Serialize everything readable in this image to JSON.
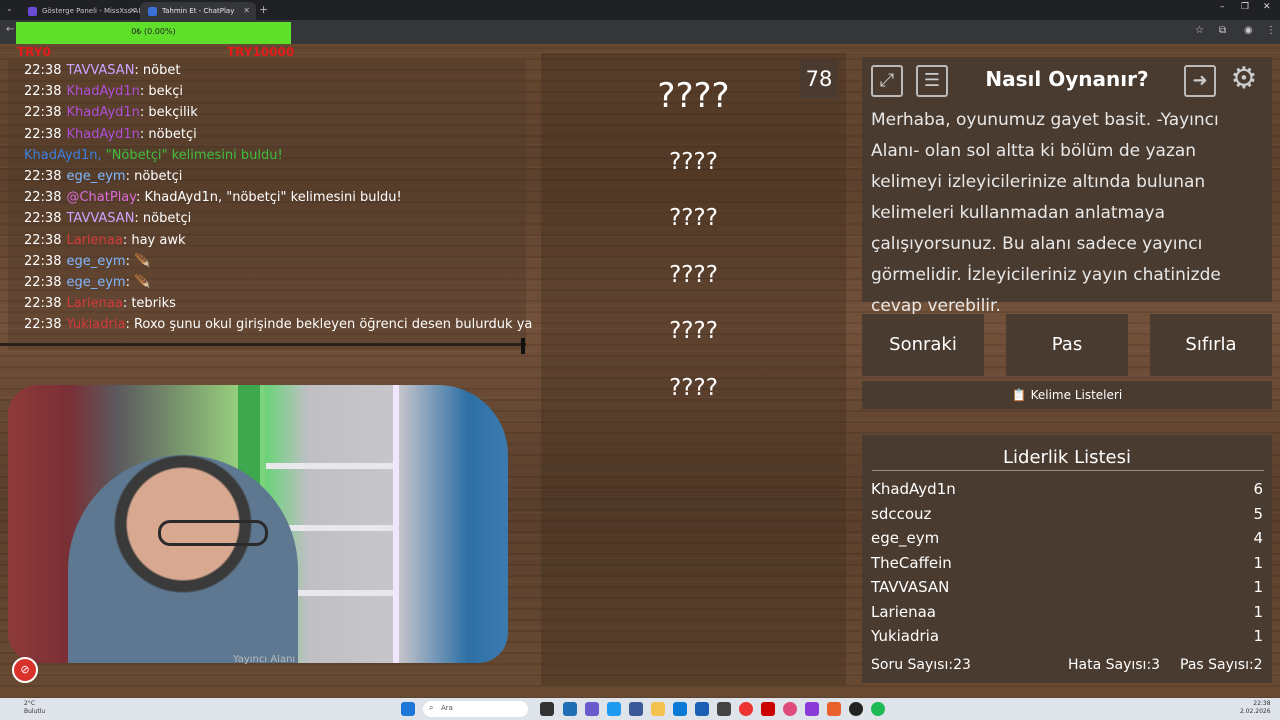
{
  "browser": {
    "tabs": [
      {
        "title": "Gösterge Paneli - MissXss AI B...",
        "active": false
      },
      {
        "title": "Tahmin Et - ChatPlay",
        "active": true
      }
    ],
    "new_tab": "+"
  },
  "overlay": {
    "progress_text": "0₺ (0.00%)",
    "progress_fraction": 0.0,
    "min_label": "TRY0",
    "max_label": "TRY10000"
  },
  "chat": {
    "lines": [
      {
        "time": "22:38",
        "user": "TAVVASAN",
        "user_color": "#c8a6ff",
        "message": ": nöbet"
      },
      {
        "time": "22:38",
        "user": "KhadAyd1n",
        "user_color": "#b04fd6",
        "message": ": bekçi"
      },
      {
        "time": "22:38",
        "user": "KhadAyd1n",
        "user_color": "#b04fd6",
        "message": ": bekçilik"
      },
      {
        "time": "22:38",
        "user": "KhadAyd1n",
        "user_color": "#b04fd6",
        "message": ": nöbetçi"
      },
      {
        "time": "",
        "user": "KhadAyd1n, ",
        "user_color": "#3a7fe0",
        "message": "\"Nöbetçi\" kelimesini buldu!",
        "system": true
      },
      {
        "time": "22:38",
        "user": "ege_eym",
        "user_color": "#7fb6ff",
        "message": ": nöbetçi"
      },
      {
        "time": "22:38",
        "user": "@ChatPlay",
        "user_color": "#d86bd8",
        "message": ": KhadAyd1n, \"nöbetçi\" kelimesini buldu!"
      },
      {
        "time": "22:38",
        "user": "TAVVASAN",
        "user_color": "#c8a6ff",
        "message": ": nöbetçi"
      },
      {
        "time": "22:38",
        "user": "Larienaa",
        "user_color": "#d23a3a",
        "message": ": hay awk"
      },
      {
        "time": "22:38",
        "user": "ege_eym",
        "user_color": "#7fb6ff",
        "message": ": 🪶"
      },
      {
        "time": "22:38",
        "user": "ege_eym",
        "user_color": "#7fb6ff",
        "message": ": 🪶"
      },
      {
        "time": "22:38",
        "user": "Larienaa",
        "user_color": "#d23a3a",
        "message": ": tebriks"
      },
      {
        "time": "22:38",
        "user": "Yukiadria",
        "user_color": "#d23a3a",
        "message": ": Roxo şunu okul girişinde bekleyen öğrenci desen bulurduk ya"
      }
    ]
  },
  "webcam": {
    "label": "Yayıncı Alanı",
    "rec_icon": "record-icon"
  },
  "board": {
    "counter": "78",
    "words": [
      "????",
      "????",
      "????",
      "????",
      "????",
      "????"
    ]
  },
  "howto": {
    "title": "Nasıl Oynanır?",
    "text": "Merhaba, oyunumuz gayet basit. -Yayıncı Alanı- olan sol altta ki bölüm de yazan kelimeyi izleyicilerinize altında bulunan kelimeleri kullanmadan anlatmaya çalışıyorsunuz. Bu alanı sadece yayıncı görmelidir. İzleyicileriniz yayın chatinizde cevap verebilir.",
    "icons": {
      "fullscreen": "fullscreen-icon",
      "list": "document-icon",
      "exit": "exit-icon",
      "settings": "gear-icon"
    }
  },
  "controls": {
    "next": "Sonraki",
    "pass": "Pas",
    "reset": "Sıfırla",
    "word_lists": "Kelime Listeleri",
    "word_lists_icon": "📋"
  },
  "leaderboard": {
    "title": "Liderlik Listesi",
    "rows": [
      {
        "name": "KhadAyd1n",
        "score": "6"
      },
      {
        "name": "sdccouz",
        "score": "5"
      },
      {
        "name": "ege_eym",
        "score": "4"
      },
      {
        "name": "TheCaffein",
        "score": "1"
      },
      {
        "name": "TAVVASAN",
        "score": "1"
      },
      {
        "name": "Larienaa",
        "score": "1"
      },
      {
        "name": "Yukiadria",
        "score": "1"
      }
    ],
    "stats": {
      "questions": "Soru Sayısı:23",
      "errors": "Hata Sayısı:3",
      "passes": "Pas Sayısı:2"
    }
  },
  "taskbar": {
    "weather_temp": "2°C",
    "weather_desc": "Bulutlu",
    "search_placeholder": "Ara",
    "time": "22:38",
    "date": "2.02.2026"
  }
}
